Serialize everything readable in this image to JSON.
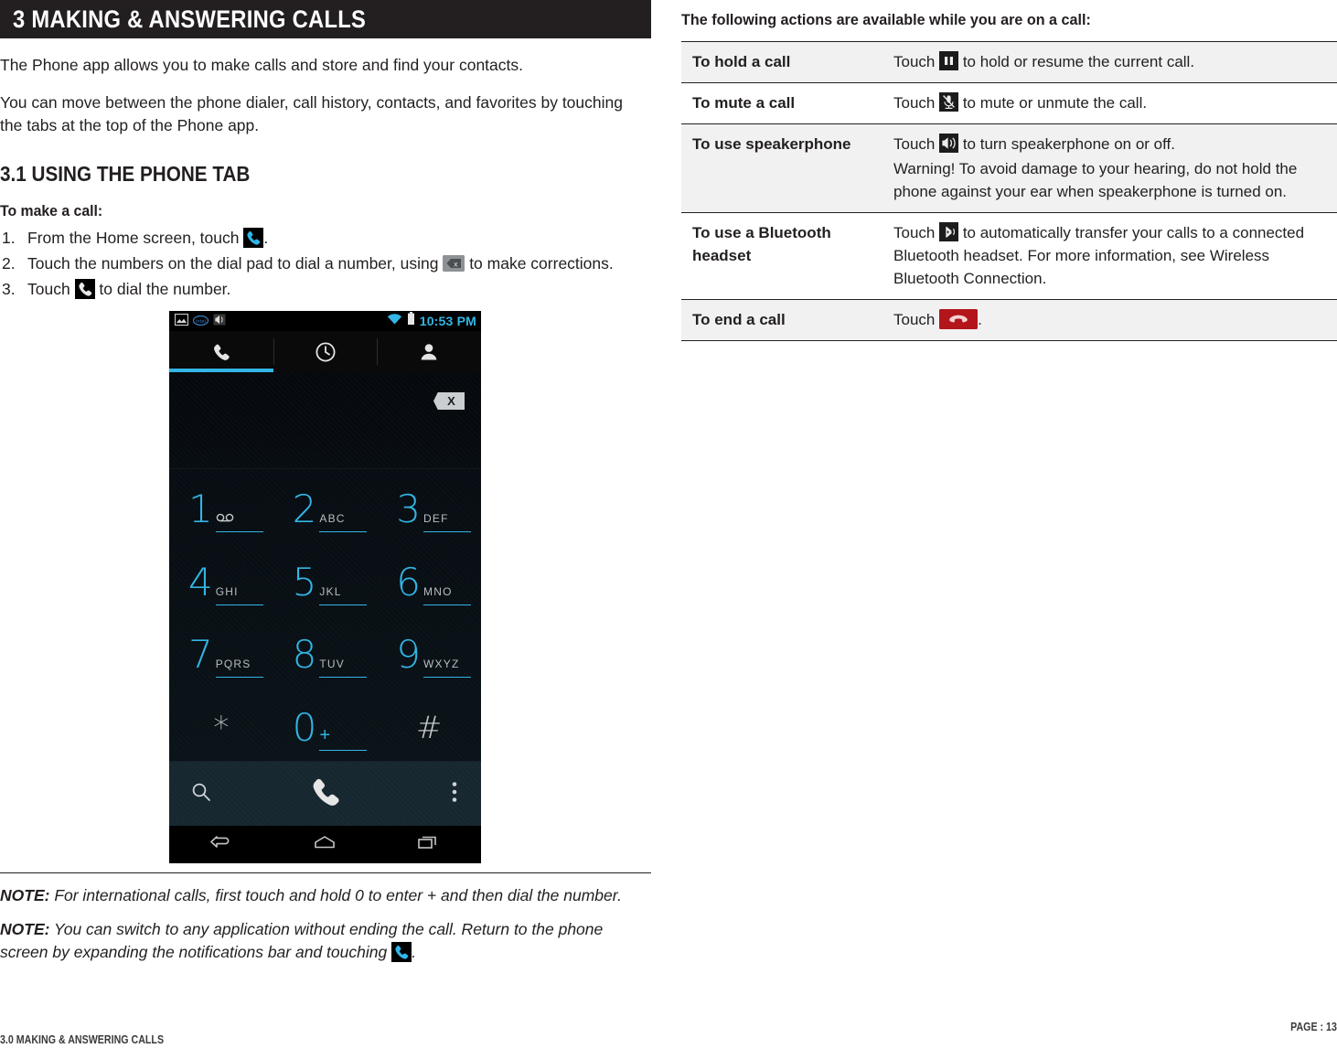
{
  "chapter": {
    "banner_title": "3 MAKING & ANSWERING CALLS"
  },
  "intro": {
    "p1": "The Phone app allows you to make calls and store and find your contacts.",
    "p2": "You can move between the phone dialer, call history, contacts, and favorites by touching the tabs at the top of the Phone app."
  },
  "section": {
    "heading": "3.1 USING THE PHONE TAB",
    "lead": "To make a call:",
    "steps": [
      {
        "num": "1.",
        "before": "From the Home screen, touch ",
        "after": "."
      },
      {
        "num": "2.",
        "before": "Touch the numbers on the dial pad to dial a number, using ",
        "after": " to make corrections."
      },
      {
        "num": "3.",
        "before": "Touch ",
        "after": " to dial the number."
      }
    ]
  },
  "phone": {
    "status": {
      "time": "10:53 PM"
    },
    "tabs": [
      {
        "name": "phone-tab",
        "active": true
      },
      {
        "name": "history-tab",
        "active": false
      },
      {
        "name": "contacts-tab",
        "active": false
      }
    ],
    "keys": [
      {
        "digit": "1",
        "sub": "oo",
        "voicemail": true
      },
      {
        "digit": "2",
        "sub": "ABC",
        "voicemail": false
      },
      {
        "digit": "3",
        "sub": "DEF",
        "voicemail": false
      },
      {
        "digit": "4",
        "sub": "GHI",
        "voicemail": false
      },
      {
        "digit": "5",
        "sub": "JKL",
        "voicemail": false
      },
      {
        "digit": "6",
        "sub": "MNO",
        "voicemail": false
      },
      {
        "digit": "7",
        "sub": "PQRS",
        "voicemail": false
      },
      {
        "digit": "8",
        "sub": "TUV",
        "voicemail": false
      },
      {
        "digit": "9",
        "sub": "WXYZ",
        "voicemail": false
      },
      {
        "digit": "*",
        "sub": "",
        "voicemail": false
      },
      {
        "digit": "0",
        "sub": "+",
        "voicemail": false
      },
      {
        "digit": "#",
        "sub": "",
        "voicemail": false
      }
    ],
    "delete_key_label": "X"
  },
  "notes": [
    {
      "label": "NOTE:",
      "text": " For international calls, first touch and hold 0 to enter + and then dial the number."
    },
    {
      "label": "NOTE:",
      "text_before": " You can switch to any application without ending the call. Return to the phone screen by expanding the notifications bar and touching ",
      "text_after": "."
    }
  ],
  "actions_table": {
    "intro": "The following actions are available while you are on a call:",
    "rows": [
      {
        "term": "To hold a call",
        "icon": "pause-icon",
        "lines": [
          {
            "before": "Touch ",
            "after": " to hold or resume the current call."
          }
        ]
      },
      {
        "term": "To mute a call",
        "icon": "mute-microphone-icon",
        "lines": [
          {
            "before": "Touch ",
            "after": " to mute or unmute the call."
          }
        ]
      },
      {
        "term": "To use speakerphone",
        "icon": "speaker-icon",
        "lines": [
          {
            "before": "Touch ",
            "after": " to turn speakerphone on or off."
          }
        ],
        "extra": "Warning! To avoid damage to your hearing, do not hold the phone against your ear when speakerphone is turned on."
      },
      {
        "term": "To use a Bluetooth headset",
        "icon": "bluetooth-icon",
        "lines": [
          {
            "before": "Touch ",
            "after": " to automatically transfer your calls to a connected Bluetooth headset. For more information, see Wireless Bluetooth Connection."
          }
        ]
      },
      {
        "term": "To end a call",
        "icon": "end-call-icon",
        "lines": [
          {
            "before": "Touch ",
            "after": "."
          }
        ]
      }
    ]
  },
  "footer": {
    "left": "3.0 MAKING & ANSWERING CALLS",
    "right": "PAGE : 13"
  },
  "colors": {
    "accent_blue": "#33b5e5",
    "banner_black": "#231f20",
    "row_shade": "#f1f1f1",
    "end_call_red": "#b3151a"
  }
}
